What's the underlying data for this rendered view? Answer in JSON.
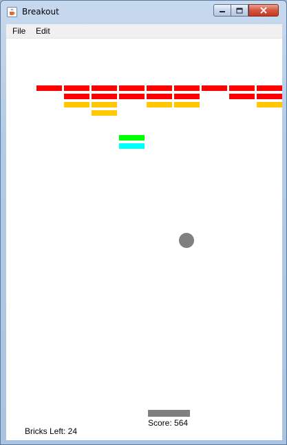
{
  "window": {
    "title": "Breakout",
    "icon": "java-coffee-cup-icon",
    "controls": [
      "minimize-icon",
      "maximize-icon",
      "close-icon"
    ]
  },
  "menu": {
    "file": "File",
    "edit": "Edit"
  },
  "game": {
    "score_text": "Score: 564",
    "bricks_left_text": "Bricks Left: 24",
    "ball_color": "#808080",
    "paddle_color": "#808080",
    "colors": {
      "red": "#ff0000",
      "orange": "#ffc800",
      "green": "#00ff00",
      "cyan": "#00ffff"
    },
    "brick_grid": [
      [
        "red",
        "red",
        "red",
        "red",
        "red",
        "red",
        "red",
        "red",
        "red"
      ],
      [
        null,
        "red",
        "red",
        "red",
        "red",
        "red",
        null,
        "red",
        "red"
      ],
      [
        null,
        "orange",
        "orange",
        null,
        "orange",
        "orange",
        null,
        null,
        "orange"
      ],
      [
        null,
        null,
        "orange",
        null,
        null,
        null,
        null,
        null,
        null
      ],
      [
        null,
        null,
        null,
        null,
        null,
        null,
        null,
        null,
        null
      ],
      [
        null,
        null,
        null,
        null,
        null,
        null,
        null,
        null,
        null
      ],
      [
        null,
        null,
        null,
        "green",
        null,
        null,
        null,
        null,
        null
      ],
      [
        null,
        null,
        null,
        "cyan",
        null,
        null,
        null,
        null,
        null
      ]
    ]
  }
}
